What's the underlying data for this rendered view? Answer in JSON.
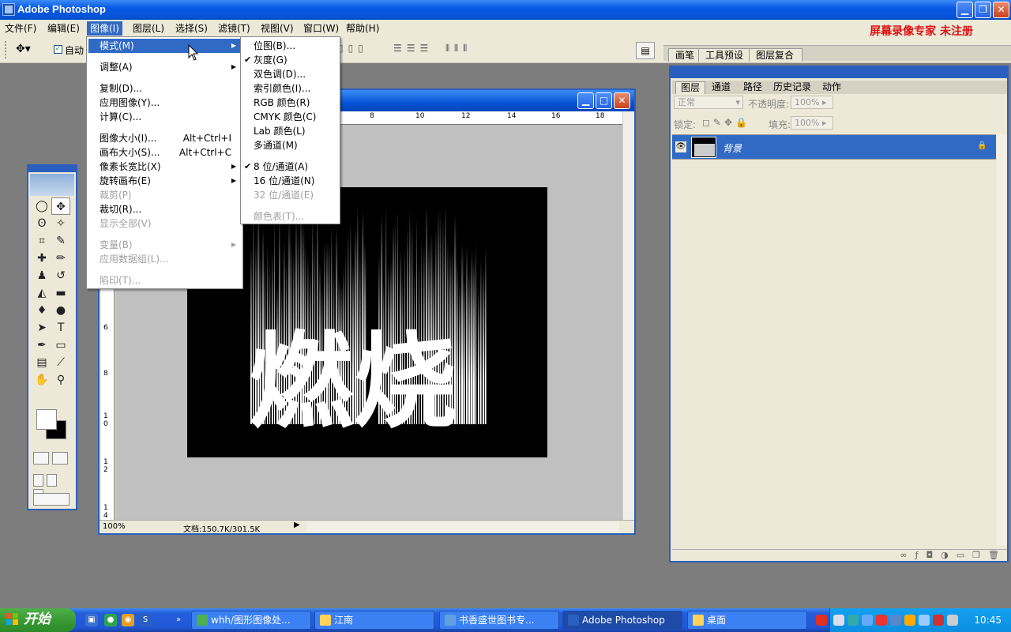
{
  "app": {
    "title": "Adobe Photoshop"
  },
  "menubar": {
    "items": [
      {
        "label": "文件(F)"
      },
      {
        "label": "编辑(E)"
      },
      {
        "label": "图像(I)"
      },
      {
        "label": "图层(L)"
      },
      {
        "label": "选择(S)"
      },
      {
        "label": "滤镜(T)"
      },
      {
        "label": "视图(V)"
      },
      {
        "label": "窗口(W)"
      },
      {
        "label": "帮助(H)"
      }
    ],
    "registration": "屏幕录像专家  未注册"
  },
  "options": {
    "auto_select_label": "自动"
  },
  "palette_well": {
    "tabs": [
      "画笔",
      "工具预设",
      "图层复合"
    ]
  },
  "image_menu": {
    "items": [
      {
        "label": "模式(M)",
        "submenu": true,
        "highlighted": true
      },
      {
        "label": "调整(A)",
        "submenu": true
      },
      {
        "label": "复制(D)..."
      },
      {
        "label": "应用图像(Y)..."
      },
      {
        "label": "计算(C)..."
      },
      {
        "label": "图像大小(I)...",
        "shortcut": "Alt+Ctrl+I"
      },
      {
        "label": "画布大小(S)...",
        "shortcut": "Alt+Ctrl+C"
      },
      {
        "label": "像素长宽比(X)",
        "submenu": true
      },
      {
        "label": "旋转画布(E)",
        "submenu": true
      },
      {
        "label": "裁剪(P)",
        "disabled": true
      },
      {
        "label": "裁切(R)..."
      },
      {
        "label": "显示全部(V)",
        "disabled": true
      },
      {
        "label": "变量(B)",
        "submenu": true,
        "disabled": true
      },
      {
        "label": "应用数据组(L)...",
        "disabled": true
      },
      {
        "label": "陷印(T)...",
        "disabled": true
      }
    ]
  },
  "mode_menu": {
    "items": [
      {
        "label": "位图(B)..."
      },
      {
        "label": "灰度(G)",
        "checked": true
      },
      {
        "label": "双色调(D)..."
      },
      {
        "label": "索引颜色(I)..."
      },
      {
        "label": "RGB 颜色(R)"
      },
      {
        "label": "CMYK 颜色(C)"
      },
      {
        "label": "Lab 颜色(L)"
      },
      {
        "label": "多通道(M)"
      },
      {
        "label": "8 位/通道(A)",
        "checked": true
      },
      {
        "label": "16 位/通道(N)"
      },
      {
        "label": "32 位/通道(E)",
        "disabled": true
      },
      {
        "label": "颜色表(T)...",
        "disabled": true
      }
    ]
  },
  "document": {
    "zoom": "100%",
    "info": "文档:150.7K/301.5K",
    "ruler_top": [
      "8",
      "10",
      "12",
      "14",
      "16",
      "18"
    ],
    "ruler_left": [
      "6",
      "8",
      "1\n0",
      "1\n2",
      "1\n4"
    ],
    "image_text": "燃烧"
  },
  "layers_panel": {
    "tabs": [
      "图层",
      "通道",
      "路径",
      "历史记录",
      "动作"
    ],
    "blend_mode": "正常",
    "opacity_label": "不透明度:",
    "opacity_value": "100%",
    "lock_label": "锁定:",
    "fill_label": "填充:",
    "fill_value": "100%",
    "layers": [
      {
        "name": "背景",
        "locked": true,
        "visible": true
      }
    ]
  },
  "taskbar": {
    "start_label": "开始",
    "tasks": [
      {
        "label": "whh/图形图像处..."
      },
      {
        "label": "江南"
      },
      {
        "label": "书香盛世图书专..."
      },
      {
        "label": "Adobe Photoshop",
        "active": true
      },
      {
        "label": "桌面"
      }
    ],
    "clock": "10:45"
  },
  "colors": {
    "xp_blue": "#0653d6",
    "menu_highlight": "#316ac5",
    "registration_red": "#e01010",
    "workspace": "#7d7d7d"
  }
}
